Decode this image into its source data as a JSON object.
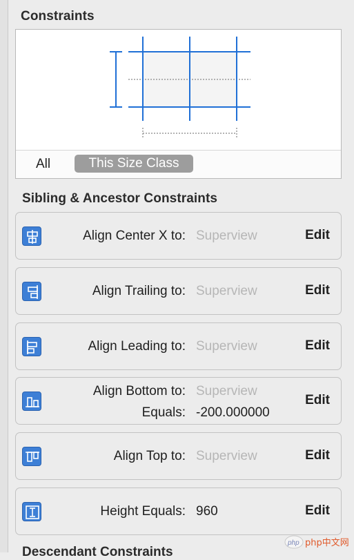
{
  "constraints": {
    "title": "Constraints",
    "size_class": {
      "all_label": "All",
      "active_label": "This Size Class"
    }
  },
  "sibling_section": {
    "title": "Sibling & Ancestor Constraints"
  },
  "rows": [
    {
      "icon": "align-center-x-icon",
      "label": "Align Center X to:",
      "value": "Superview",
      "edit": "Edit"
    },
    {
      "icon": "align-trailing-icon",
      "label": "Align Trailing to:",
      "value": "Superview",
      "edit": "Edit"
    },
    {
      "icon": "align-leading-icon",
      "label": "Align Leading to:",
      "value": "Superview",
      "edit": "Edit"
    },
    {
      "icon": "align-bottom-icon",
      "label": "Align Bottom to:",
      "value": "Superview",
      "label2": "Equals:",
      "value2": "-200.000000",
      "edit": "Edit"
    },
    {
      "icon": "align-top-icon",
      "label": "Align Top to:",
      "value": "Superview",
      "edit": "Edit"
    },
    {
      "icon": "height-icon",
      "label": "Height Equals:",
      "value": "960",
      "edit": "Edit"
    }
  ],
  "descendant_section": {
    "title": "Descendant Constraints"
  },
  "watermark": {
    "text": "php中文网"
  },
  "colors": {
    "accent": "#3d7fd6",
    "line": "#1f6fd6",
    "muted": "#b6b6b6"
  }
}
